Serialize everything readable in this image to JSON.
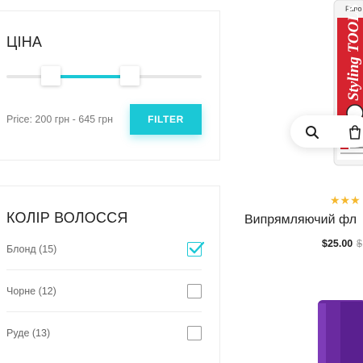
{
  "price_filter": {
    "title": "ЦІНА",
    "min_value": 200,
    "max_value": 645,
    "price_text": "Price: 200 грн - 645 грн",
    "filter_button": "FILTER"
  },
  "hair_color": {
    "title": "КОЛІР ВОЛОССЯ",
    "options": [
      {
        "label": "Блонд (15)",
        "checked": true
      },
      {
        "label": "Чорне (12)",
        "checked": false
      },
      {
        "label": "Руде (13)",
        "checked": false
      }
    ]
  },
  "product_1": {
    "brand_text": "Fano",
    "image_text": "Styling TOOLS",
    "rating_stars": "★★★",
    "title": "Випрямляючий фл",
    "price": "$25.00",
    "old_price": "$"
  },
  "colors": {
    "accent": "#1bc8d6",
    "star": "#f5b82e",
    "product_red": "#d6232f",
    "product_purple": "#6a2aa0"
  },
  "icons": [
    "search-icon",
    "shopping-bag-icon"
  ]
}
